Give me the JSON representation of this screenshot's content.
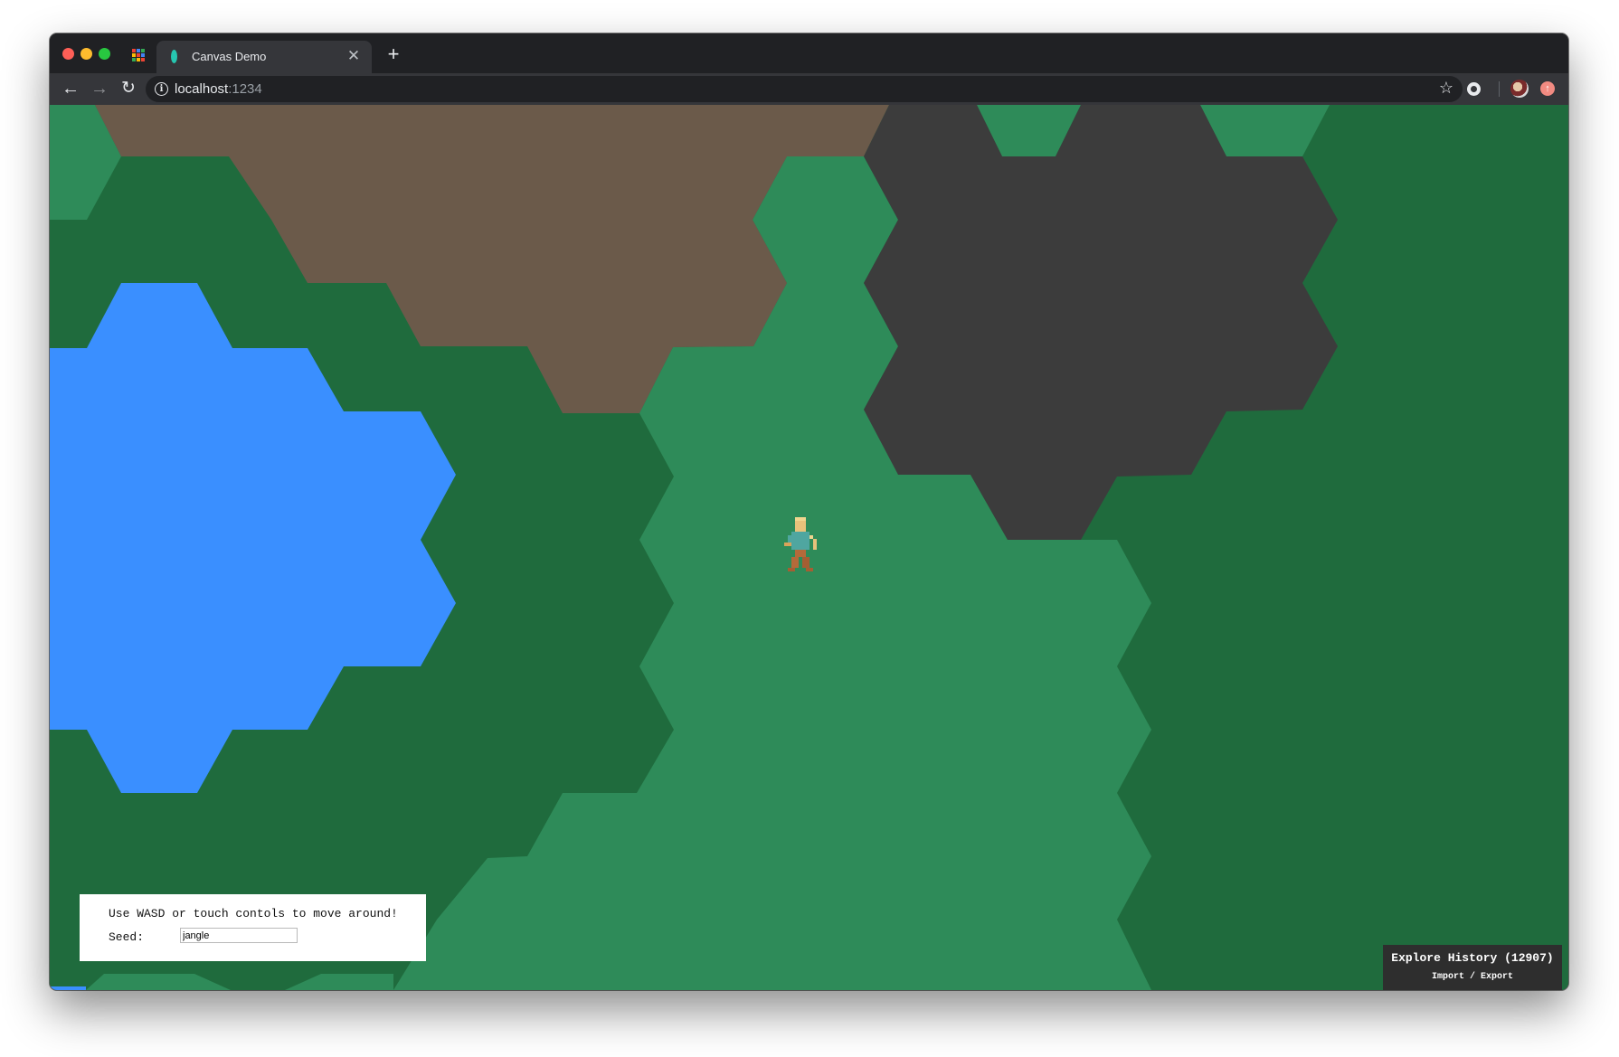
{
  "browser": {
    "tab_title": "Canvas Demo",
    "url_host": "localhost",
    "url_port": ":1234",
    "icons": {
      "back": "arrow-left-icon",
      "forward": "arrow-right-icon",
      "reload": "reload-icon",
      "info": "info-icon",
      "bookmark": "star-icon",
      "new_tab": "plus-icon",
      "close_tab": "close-icon"
    }
  },
  "game": {
    "instructions": "Use WASD or touch contols to move around!",
    "seed_label": "Seed:",
    "seed_value": "jangle",
    "history_title": "Explore History (12907)",
    "history_links": "Import / Export"
  },
  "colors": {
    "forest": "#1f6b3d",
    "grass": "#2e8b59",
    "dirt": "#6b5a4a",
    "rock": "#3c3c3c",
    "water": "#3a8fff"
  }
}
